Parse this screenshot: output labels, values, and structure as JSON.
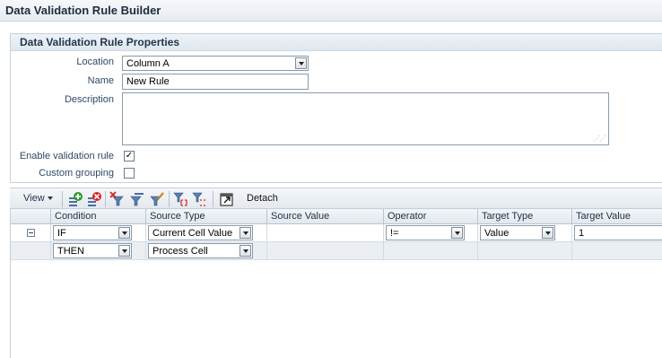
{
  "window": {
    "title": "Data Validation Rule Builder"
  },
  "properties": {
    "header": "Data Validation Rule Properties",
    "location": {
      "label": "Location",
      "value": "Column A"
    },
    "name": {
      "label": "Name",
      "value": "New Rule"
    },
    "description": {
      "label": "Description",
      "value": ""
    },
    "enable": {
      "label": "Enable validation rule",
      "checked": true,
      "mark": "✓"
    },
    "grouping": {
      "label": "Custom grouping",
      "checked": false,
      "mark": ""
    }
  },
  "toolbar": {
    "view_label": "View",
    "detach_label": "Detach",
    "icons": [
      "add-condition-icon",
      "delete-condition-icon",
      "remove-filter-icon",
      "filter-icon",
      "edit-filter-icon",
      "filter-group-icon",
      "filter-ungroup-icon",
      "detach-icon"
    ]
  },
  "grid": {
    "columns": [
      "Condition",
      "Source Type",
      "Source Value",
      "Operator",
      "Target Type",
      "Target Value"
    ],
    "rows": [
      {
        "condition": "IF",
        "source_type": "Current Cell Value",
        "source_value": "",
        "operator": "!=",
        "target_type": "Value",
        "target_value": "1"
      },
      {
        "condition": "THEN",
        "source_type": "Process Cell",
        "source_value": "",
        "operator": "",
        "target_type": "",
        "target_value": ""
      }
    ]
  }
}
